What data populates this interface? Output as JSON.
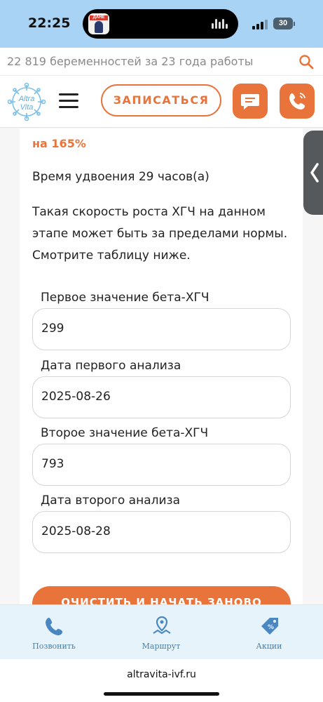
{
  "status_bar": {
    "time": "22:25",
    "app_badge": "ДАНЕ",
    "battery": "30"
  },
  "topline": {
    "text": "22 819 беременностей за 23 года работы",
    "search_icon": "search-icon"
  },
  "header": {
    "logo_text": "Altra Vita",
    "book_button": "ЗАПИСАТЬСЯ",
    "chat_icon": "chat-icon",
    "call_icon": "phone-call-icon",
    "accent_color": "#e8743b"
  },
  "result": {
    "percent_line": "на 165%",
    "doubling_time": "Время удвоения 29 часов(а)",
    "note": "Такая скорость роста ХГЧ на данном этапе может быть за пределами нормы. Смотрите таблицу ниже."
  },
  "form": {
    "fields": [
      {
        "label": "Первое значение бета-ХГЧ",
        "value": "299"
      },
      {
        "label": "Дата первого анализа",
        "value": "2025-08-26"
      },
      {
        "label": "Второе значение бета-ХГЧ",
        "value": "793"
      },
      {
        "label": "Дата второго анализа",
        "value": "2025-08-28"
      }
    ],
    "reset_button": "ОЧИСТИТЬ И НАЧАТЬ ЗАНОВО"
  },
  "bottom_nav": {
    "items": [
      {
        "label": "Позвонить",
        "icon": "phone-icon"
      },
      {
        "label": "Маршрут",
        "icon": "map-pin-icon"
      },
      {
        "label": "Акции",
        "icon": "discount-tag-icon"
      }
    ]
  },
  "browser": {
    "url": "altravita-ivf.ru"
  }
}
